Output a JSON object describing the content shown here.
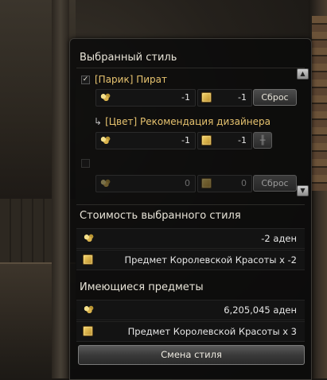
{
  "panel": {
    "selected_title": "Выбранный стиль",
    "cost_title": "Стоимость выбранного стиля",
    "owned_title": "Имеющиеся предметы",
    "change_button": "Смена стиля"
  },
  "styles": [
    {
      "checked": true,
      "name": "[Парик] Пират",
      "adena": "-1",
      "coupon": "-1",
      "reset_label": "Сброс"
    },
    {
      "sub": true,
      "arrow": "↳",
      "name": "[Цвет] Рекомендация дизайнера",
      "adena": "-1",
      "coupon": "-1"
    },
    {
      "checked": false,
      "name": "",
      "adena": "0",
      "coupon": "0",
      "reset_label": "Сброс"
    }
  ],
  "cost": {
    "adena_text": "-2 аден",
    "coupon_text": "Предмет Королевской Красоты x -2"
  },
  "owned": {
    "adena_text": "6,205,045 аден",
    "coupon_text": "Предмет Королевской Красоты x 3"
  },
  "icons": {
    "scroll_up": "▲",
    "scroll_down": "▼",
    "check": "✓",
    "color_picker": "╫"
  }
}
